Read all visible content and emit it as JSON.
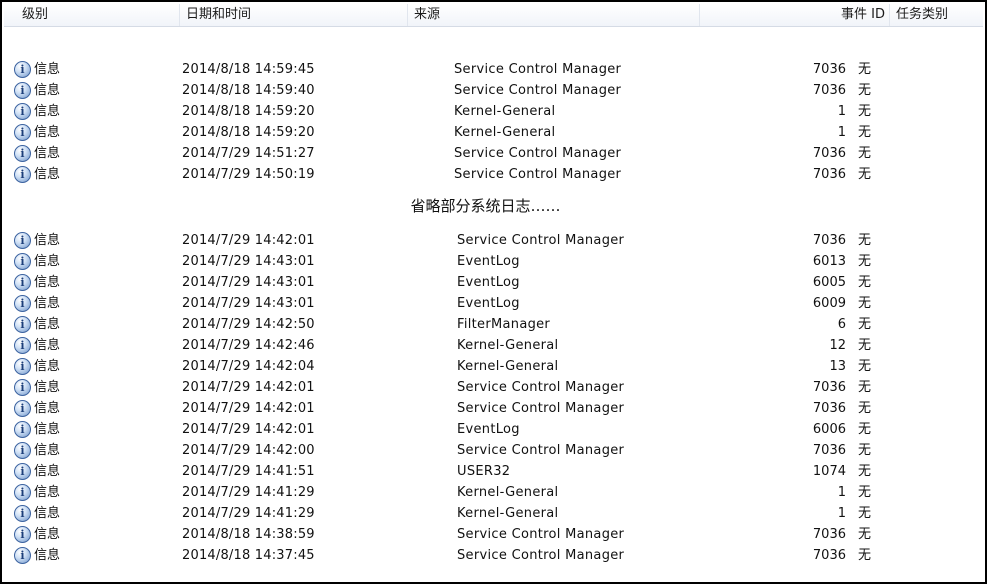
{
  "header": {
    "level": "级别",
    "datetime": "日期和时间",
    "source": "来源",
    "event_id": "事件 ID",
    "task_category": "任务类别"
  },
  "icon_glyph": "i",
  "note": "省略部分系统日志……",
  "group1": [
    {
      "level": "信息",
      "datetime": "2014/8/18 14:59:45",
      "source": "Service Control Manager",
      "event_id": "7036",
      "task": "无"
    },
    {
      "level": "信息",
      "datetime": "2014/8/18 14:59:40",
      "source": "Service Control Manager",
      "event_id": "7036",
      "task": "无"
    },
    {
      "level": "信息",
      "datetime": "2014/8/18 14:59:20",
      "source": "Kernel-General",
      "event_id": "1",
      "task": "无"
    },
    {
      "level": "信息",
      "datetime": "2014/8/18 14:59:20",
      "source": "Kernel-General",
      "event_id": "1",
      "task": "无"
    },
    {
      "level": "信息",
      "datetime": "2014/7/29 14:51:27",
      "source": "Service Control Manager",
      "event_id": "7036",
      "task": "无"
    },
    {
      "level": "信息",
      "datetime": "2014/7/29 14:50:19",
      "source": "Service Control Manager",
      "event_id": "7036",
      "task": "无"
    }
  ],
  "group2": [
    {
      "level": "信息",
      "datetime": "2014/7/29 14:42:01",
      "source": "Service Control Manager",
      "event_id": "7036",
      "task": "无"
    },
    {
      "level": "信息",
      "datetime": "2014/7/29 14:43:01",
      "source": "EventLog",
      "event_id": "6013",
      "task": "无"
    },
    {
      "level": "信息",
      "datetime": "2014/7/29 14:43:01",
      "source": "EventLog",
      "event_id": "6005",
      "task": "无"
    },
    {
      "level": "信息",
      "datetime": "2014/7/29 14:43:01",
      "source": "EventLog",
      "event_id": "6009",
      "task": "无"
    },
    {
      "level": "信息",
      "datetime": "2014/7/29 14:42:50",
      "source": "FilterManager",
      "event_id": "6",
      "task": "无"
    },
    {
      "level": "信息",
      "datetime": "2014/7/29 14:42:46",
      "source": "Kernel-General",
      "event_id": "12",
      "task": "无"
    },
    {
      "level": "信息",
      "datetime": "2014/7/29 14:42:04",
      "source": "Kernel-General",
      "event_id": "13",
      "task": "无"
    },
    {
      "level": "信息",
      "datetime": "2014/7/29 14:42:01",
      "source": "Service Control Manager",
      "event_id": "7036",
      "task": "无"
    },
    {
      "level": "信息",
      "datetime": "2014/7/29 14:42:01",
      "source": "Service Control Manager",
      "event_id": "7036",
      "task": "无"
    },
    {
      "level": "信息",
      "datetime": "2014/7/29 14:42:01",
      "source": "EventLog",
      "event_id": "6006",
      "task": "无"
    },
    {
      "level": "信息",
      "datetime": "2014/7/29 14:42:00",
      "source": "Service Control Manager",
      "event_id": "7036",
      "task": "无"
    },
    {
      "level": "信息",
      "datetime": "2014/7/29 14:41:51",
      "source": "USER32",
      "event_id": "1074",
      "task": "无"
    },
    {
      "level": "信息",
      "datetime": "2014/7/29 14:41:29",
      "source": "Kernel-General",
      "event_id": "1",
      "task": "无"
    },
    {
      "level": "信息",
      "datetime": "2014/7/29 14:41:29",
      "source": "Kernel-General",
      "event_id": "1",
      "task": "无"
    },
    {
      "level": "信息",
      "datetime": "2014/8/18 14:38:59",
      "source": "Service Control Manager",
      "event_id": "7036",
      "task": "无"
    },
    {
      "level": "信息",
      "datetime": "2014/8/18 14:37:45",
      "source": "Service Control Manager",
      "event_id": "7036",
      "task": "无"
    }
  ]
}
